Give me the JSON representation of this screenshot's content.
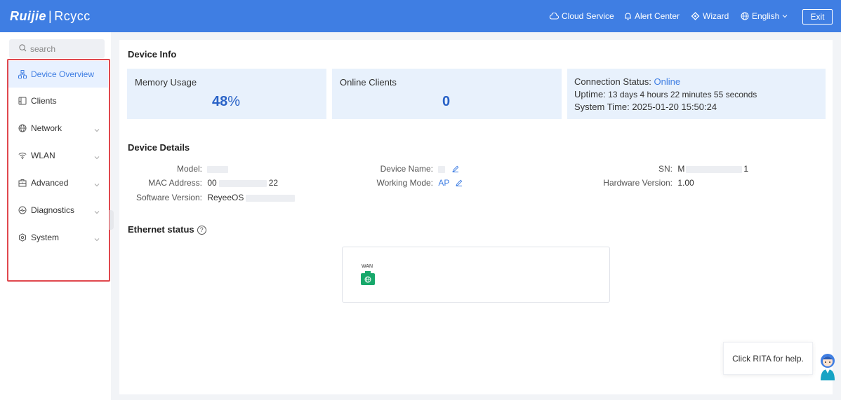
{
  "header": {
    "logo_brand": "Ruijie",
    "logo_sep": "|",
    "logo_sub": "Rcycc",
    "nav": [
      {
        "label": "Cloud Service",
        "icon": "cloud-icon"
      },
      {
        "label": "Alert Center",
        "icon": "bell-icon"
      },
      {
        "label": "Wizard",
        "icon": "wizard-icon"
      },
      {
        "label": "English",
        "icon": "globe-icon"
      }
    ],
    "exit_label": "Exit"
  },
  "sidebar": {
    "search_placeholder": "search",
    "items": [
      {
        "label": "Device Overview",
        "icon": "topology-icon",
        "active": true
      },
      {
        "label": "Clients",
        "icon": "clients-icon"
      },
      {
        "label": "Network",
        "icon": "globe-icon",
        "expandable": true
      },
      {
        "label": "WLAN",
        "icon": "wifi-icon",
        "expandable": true
      },
      {
        "label": "Advanced",
        "icon": "toolbox-icon",
        "expandable": true
      },
      {
        "label": "Diagnostics",
        "icon": "diagnostics-icon",
        "expandable": true
      },
      {
        "label": "System",
        "icon": "system-icon",
        "expandable": true
      }
    ]
  },
  "device_info": {
    "title": "Device Info",
    "memory": {
      "label": "Memory Usage",
      "value": "48",
      "unit": "%"
    },
    "clients": {
      "label": "Online Clients",
      "value": "0"
    },
    "status": {
      "connection_label": "Connection Status:",
      "connection_value": "Online",
      "uptime_label": "Uptime:",
      "uptime_value": "13 days 4 hours 22 minutes 55 seconds",
      "time_label": "System Time:",
      "time_value": "2025-01-20 15:50:24"
    }
  },
  "device_details": {
    "title": "Device Details",
    "model_label": "Model:",
    "mac_label": "MAC Address:",
    "mac_prefix": "00",
    "mac_suffix": "22",
    "software_label": "Software Version:",
    "software_value": "ReyeeOS",
    "name_label": "Device Name:",
    "mode_label": "Working Mode:",
    "mode_value": "AP",
    "sn_label": "SN:",
    "sn_prefix": "M",
    "sn_suffix": "1",
    "hw_label": "Hardware Version:",
    "hw_value": "1.00"
  },
  "ethernet": {
    "title": "Ethernet status",
    "help": "?",
    "port_label": "WAN"
  },
  "help": {
    "text": "Click RITA for help."
  },
  "colors": {
    "header_bg": "#3f7ee3",
    "accent": "#3f7ee3",
    "card_bg": "#e8f1fc",
    "port_green": "#17a86b",
    "highlight_frame": "#e0484e"
  }
}
